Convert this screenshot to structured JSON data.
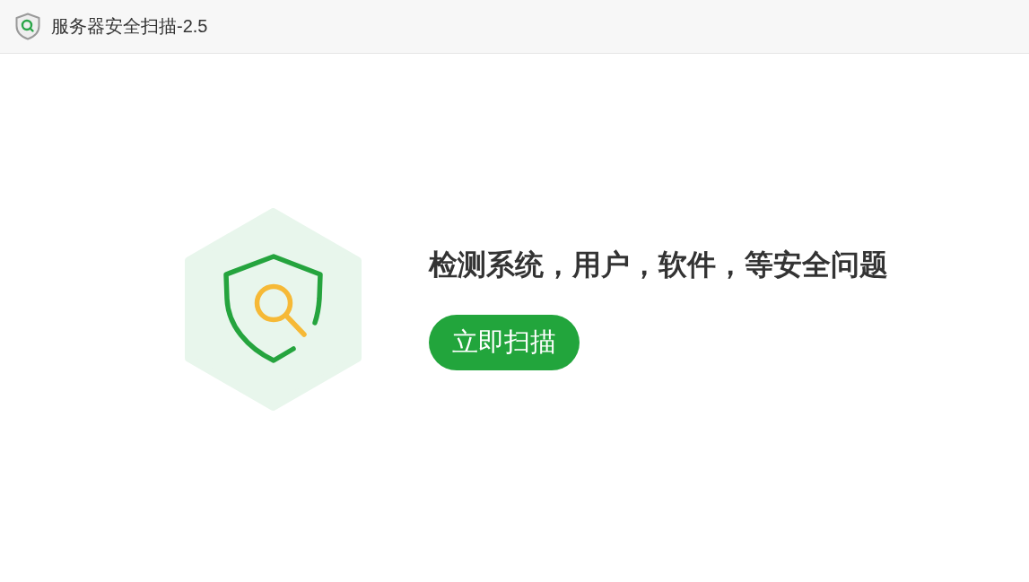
{
  "window": {
    "title": "服务器安全扫描-2.5"
  },
  "main": {
    "headline": "检测系统，用户，软件，等安全问题",
    "scan_button": "立即扫描"
  }
}
